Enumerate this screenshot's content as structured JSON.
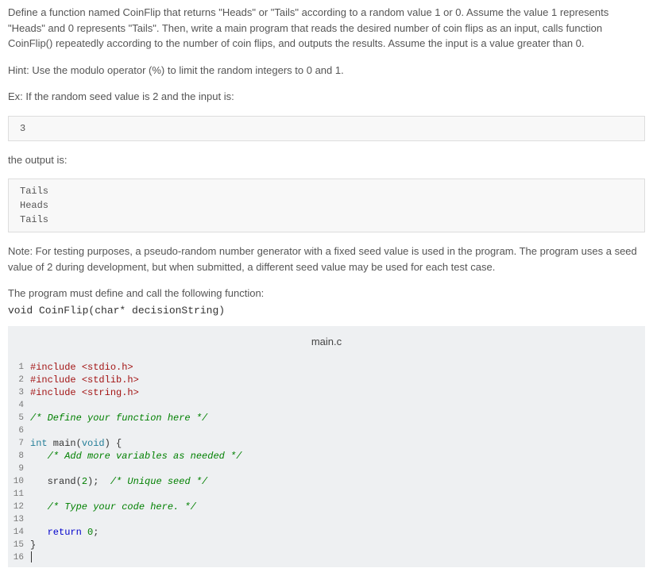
{
  "desc": {
    "p1": "Define a function named CoinFlip that returns \"Heads\" or \"Tails\" according to a random value 1 or 0. Assume the value 1 represents \"Heads\" and 0 represents \"Tails\". Then, write a main program that reads the desired number of coin flips as an input, calls function CoinFlip() repeatedly according to the number of coin flips, and outputs the results. Assume the input is a value greater than 0.",
    "p2": "Hint: Use the modulo operator (%) to limit the random integers to 0 and 1.",
    "p3": "Ex: If the random seed value is 2 and the input is:",
    "input_box": "3",
    "p4": "the output is:",
    "output_box": "Tails\nHeads\nTails",
    "p5": "Note: For testing purposes, a pseudo-random number generator with a fixed seed value is used in the program. The program uses a seed value of 2 during development, but when submitted, a different seed value may be used for each test case.",
    "p6": "The program must define and call the following function:",
    "sig": "void CoinFlip(char* decisionString)"
  },
  "editor": {
    "filename": "main.c",
    "lines": {
      "l1_inc": "#include ",
      "l1_h": "<stdio.h>",
      "l2_inc": "#include ",
      "l2_h": "<stdlib.h>",
      "l3_inc": "#include ",
      "l3_h": "<string.h>",
      "l5": "/* Define your function here */",
      "l7_a": "int",
      "l7_b": " main(",
      "l7_c": "void",
      "l7_d": ") {",
      "l8": "   /* Add more variables as needed */",
      "l10_a": "   srand(",
      "l10_b": "2",
      "l10_c": ");  ",
      "l10_d": "/* Unique seed */",
      "l12": "   /* Type your code here. */",
      "l14_a": "   ",
      "l14_b": "return",
      "l14_c": " ",
      "l14_d": "0",
      "l14_e": ";",
      "l15": "}"
    },
    "gutters": [
      "1",
      "2",
      "3",
      "4",
      "5",
      "6",
      "7",
      "8",
      "9",
      "10",
      "11",
      "12",
      "13",
      "14",
      "15",
      "16"
    ]
  }
}
